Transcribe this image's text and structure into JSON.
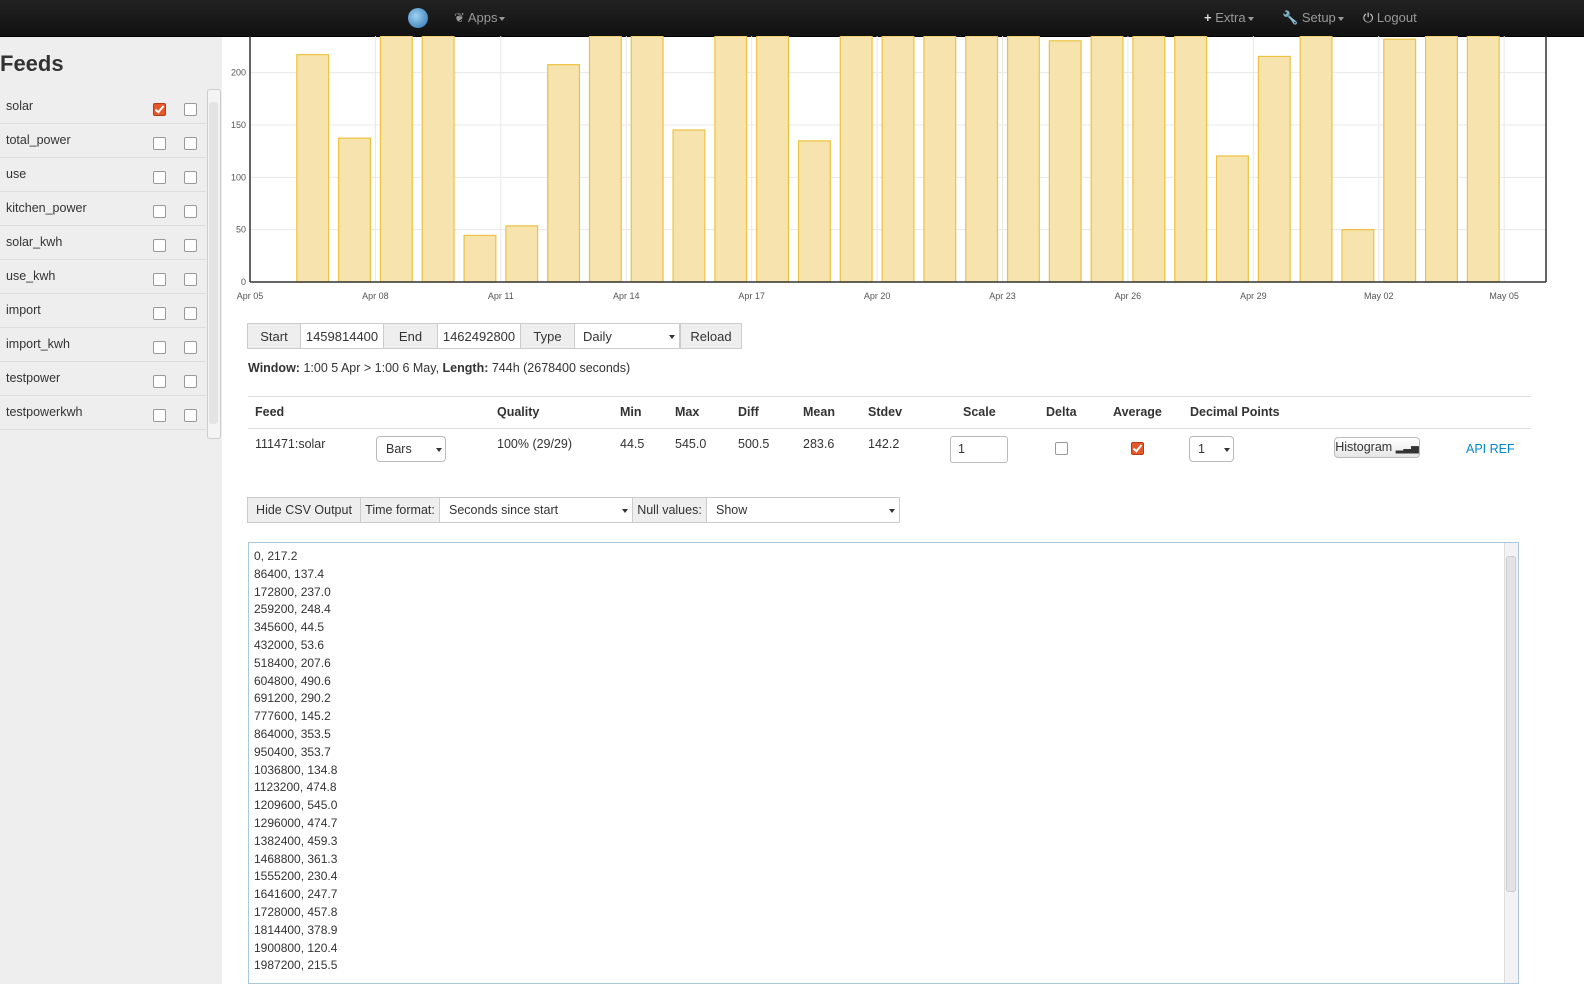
{
  "navbar": {
    "apps_label": "Apps",
    "extra_label": "Extra",
    "setup_label": "Setup",
    "logout_label": "Logout"
  },
  "sidebar": {
    "title": "Feeds",
    "feeds": [
      {
        "name": "solar",
        "left_checked": true,
        "right_checked": false
      },
      {
        "name": "total_power",
        "left_checked": false,
        "right_checked": false
      },
      {
        "name": "use",
        "left_checked": false,
        "right_checked": false
      },
      {
        "name": "kitchen_power",
        "left_checked": false,
        "right_checked": false
      },
      {
        "name": "solar_kwh",
        "left_checked": false,
        "right_checked": false
      },
      {
        "name": "use_kwh",
        "left_checked": false,
        "right_checked": false
      },
      {
        "name": "import",
        "left_checked": false,
        "right_checked": false
      },
      {
        "name": "import_kwh",
        "left_checked": false,
        "right_checked": false
      },
      {
        "name": "testpower",
        "left_checked": false,
        "right_checked": false
      },
      {
        "name": "testpowerkwh",
        "left_checked": false,
        "right_checked": false
      }
    ]
  },
  "chart_data": {
    "type": "bar",
    "bar_color": "#f7e3ae",
    "bar_edge_color": "#edc240",
    "x_tick_labels": [
      "Apr 05",
      "Apr 08",
      "Apr 11",
      "Apr 14",
      "Apr 17",
      "Apr 20",
      "Apr 23",
      "Apr 26",
      "Apr 29",
      "May 02",
      "May 05"
    ],
    "y_ticks": [
      0,
      50,
      100,
      150,
      200
    ],
    "ylim": [
      0,
      235
    ],
    "x_days": [
      0,
      1,
      2,
      3,
      4,
      5,
      6,
      7,
      8,
      9,
      10,
      11,
      12,
      13,
      14,
      15,
      16,
      17,
      18,
      19,
      20,
      21,
      22,
      23,
      24,
      25,
      26,
      27,
      28,
      29,
      30
    ],
    "values": [
      217.2,
      137.4,
      237.0,
      248.4,
      44.5,
      53.6,
      207.6,
      490.6,
      290.2,
      145.2,
      353.5,
      353.7,
      134.8,
      474.8,
      545.0,
      474.7,
      459.3,
      361.3,
      230.4,
      247.7,
      457.8,
      378.9,
      120.4,
      215.5,
      300.0,
      50.0,
      232.0,
      300.0,
      300.0
    ]
  },
  "controls": {
    "start_label": "Start",
    "start_value": "1459814400",
    "end_label": "End",
    "end_value": "1462492800",
    "type_label": "Type",
    "type_value": "Daily",
    "reload_label": "Reload"
  },
  "window_info": {
    "window_label": "Window:",
    "window_value": "1:00 5 Apr > 1:00 6 May,",
    "length_label": "Length:",
    "length_value": "744h (2678400 seconds)"
  },
  "stats": {
    "headers": {
      "feed": "Feed",
      "quality": "Quality",
      "min": "Min",
      "max": "Max",
      "diff": "Diff",
      "mean": "Mean",
      "stdev": "Stdev",
      "scale": "Scale",
      "delta": "Delta",
      "average": "Average",
      "decimal_points": "Decimal Points"
    },
    "row": {
      "feed": "111471:solar",
      "mode": "Bars",
      "quality": "100% (29/29)",
      "min": "44.5",
      "max": "545.0",
      "diff": "500.5",
      "mean": "283.6",
      "stdev": "142.2",
      "scale": "1",
      "delta_checked": false,
      "average_checked": true,
      "decimal_points": "1"
    },
    "histogram_label": "Histogram",
    "api_ref_label": "API REF"
  },
  "csv": {
    "hide_label": "Hide CSV Output",
    "time_format_label": "Time format:",
    "time_format_value": "Seconds since start",
    "null_values_label": "Null values:",
    "null_values_value": "Show",
    "lines": [
      "0, 217.2",
      "86400, 137.4",
      "172800, 237.0",
      "259200, 248.4",
      "345600, 44.5",
      "432000, 53.6",
      "518400, 207.6",
      "604800, 490.6",
      "691200, 290.2",
      "777600, 145.2",
      "864000, 353.5",
      "950400, 353.7",
      "1036800, 134.8",
      "1123200, 474.8",
      "1209600, 545.0",
      "1296000, 474.7",
      "1382400, 459.3",
      "1468800, 361.3",
      "1555200, 230.4",
      "1641600, 247.7",
      "1728000, 457.8",
      "1814400, 378.9",
      "1900800, 120.4",
      "1987200, 215.5"
    ]
  }
}
